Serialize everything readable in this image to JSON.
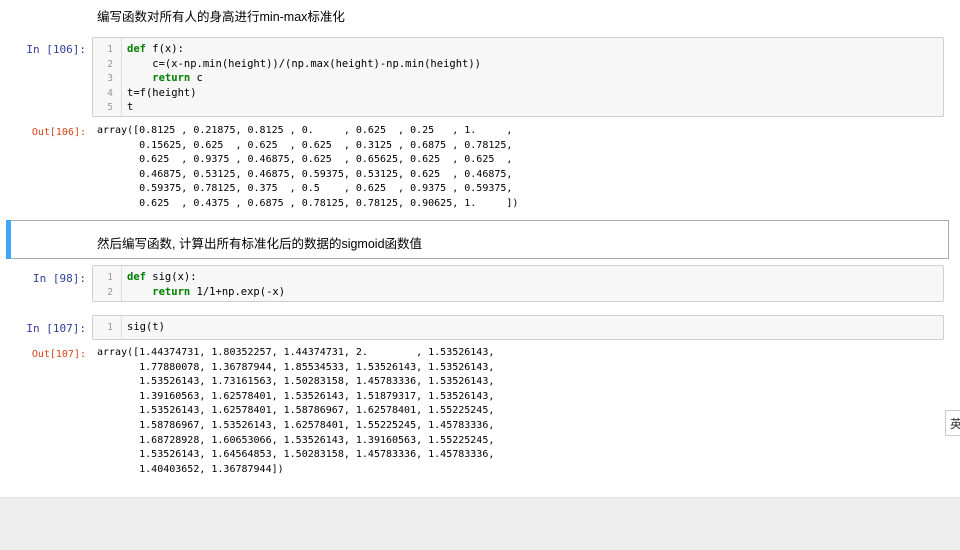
{
  "cells": {
    "md1": {
      "text": "编写函数对所有人的身高进行min-max标准化"
    },
    "in106": {
      "prompt": "In [106]:",
      "line_numbers": [
        "1",
        "2",
        "3",
        "4",
        "5"
      ],
      "lines": [
        {
          "k": "def",
          "r": " f(x):"
        },
        {
          "p": "    c=(x-np.min(height))/(np.max(height)-np.min(height))"
        },
        {
          "k": "    return",
          "r": " c"
        },
        {
          "p": "t=f(height)"
        },
        {
          "p": "t"
        }
      ]
    },
    "out106": {
      "prompt": "Out[106]:",
      "text": "array([0.8125 , 0.21875, 0.8125 , 0.     , 0.625  , 0.25   , 1.     ,\n       0.15625, 0.625  , 0.625  , 0.625  , 0.3125 , 0.6875 , 0.78125,\n       0.625  , 0.9375 , 0.46875, 0.625  , 0.65625, 0.625  , 0.625  ,\n       0.46875, 0.53125, 0.46875, 0.59375, 0.53125, 0.625  , 0.46875,\n       0.59375, 0.78125, 0.375  , 0.5    , 0.625  , 0.9375 , 0.59375,\n       0.625  , 0.4375 , 0.6875 , 0.78125, 0.78125, 0.90625, 1.     ])"
    },
    "md2": {
      "text": "然后编写函数, 计算出所有标准化后的数据的sigmoid函数值"
    },
    "in98": {
      "prompt": "In [98]:",
      "line_numbers": [
        "1",
        "2"
      ],
      "lines": [
        {
          "k": "def",
          "r": " sig(x):"
        },
        {
          "k": "    return",
          "r": " 1/1+np.exp(-x)"
        }
      ]
    },
    "in107": {
      "prompt": "In [107]:",
      "line_numbers": [
        "1"
      ],
      "lines": [
        {
          "p": "sig(t)"
        }
      ]
    },
    "out107": {
      "prompt": "Out[107]:",
      "text": "array([1.44374731, 1.80352257, 1.44374731, 2.        , 1.53526143,\n       1.77880078, 1.36787944, 1.85534533, 1.53526143, 1.53526143,\n       1.53526143, 1.73161563, 1.50283158, 1.45783336, 1.53526143,\n       1.39160563, 1.62578401, 1.53526143, 1.51879317, 1.53526143,\n       1.53526143, 1.62578401, 1.58786967, 1.62578401, 1.55225245,\n       1.58786967, 1.53526143, 1.62578401, 1.55225245, 1.45783336,\n       1.68728928, 1.60653066, 1.53526143, 1.39160563, 1.55225245,\n       1.53526143, 1.64564853, 1.50283158, 1.45783336, 1.45783336,\n       1.40403652, 1.36787944])"
    }
  },
  "ime": {
    "label": "英"
  }
}
